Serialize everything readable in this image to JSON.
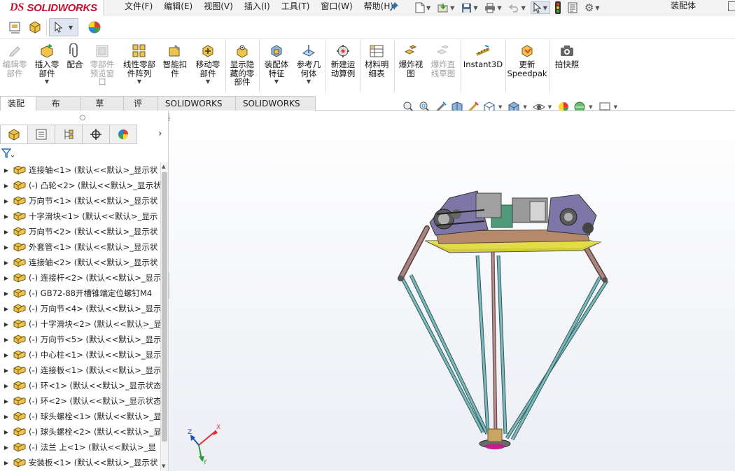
{
  "app": {
    "logo_text": "SOLIDWORKS",
    "logo_mark": "DS"
  },
  "menu": [
    {
      "label": "文件(F)"
    },
    {
      "label": "编辑(E)"
    },
    {
      "label": "视图(V)"
    },
    {
      "label": "插入(I)"
    },
    {
      "label": "工具(T)"
    },
    {
      "label": "窗口(W)"
    },
    {
      "label": "帮助(H)"
    }
  ],
  "document": {
    "title": "装配体"
  },
  "commands": [
    {
      "label": "编辑零\n部件",
      "icon": "edit-component-icon",
      "enabled": false
    },
    {
      "label": "插入零\n部件",
      "icon": "insert-component-icon",
      "enabled": true
    },
    {
      "label": "配合",
      "icon": "mate-icon",
      "enabled": true
    },
    {
      "label": "零部件\n预览窗\n口",
      "icon": "component-preview-icon",
      "enabled": false
    },
    {
      "label": "线性零部\n件阵列",
      "icon": "linear-pattern-icon",
      "enabled": true
    },
    {
      "label": "智能扣\n件",
      "icon": "smart-fasteners-icon",
      "enabled": true
    },
    {
      "label": "移动零\n部件",
      "icon": "move-component-icon",
      "enabled": true
    },
    {
      "label": "显示隐\n藏的零\n部件",
      "icon": "show-hidden-icon",
      "enabled": true
    },
    {
      "label": "装配体\n特征",
      "icon": "assembly-features-icon",
      "enabled": true
    },
    {
      "label": "参考几\n何体",
      "icon": "reference-geometry-icon",
      "enabled": true
    },
    {
      "label": "新建运\n动算例",
      "icon": "motion-study-icon",
      "enabled": true
    },
    {
      "label": "材料明\n细表",
      "icon": "bom-icon",
      "enabled": true
    },
    {
      "label": "爆炸视\n图",
      "icon": "exploded-view-icon",
      "enabled": true
    },
    {
      "label": "爆炸直\n线草图",
      "icon": "explode-line-icon",
      "enabled": false
    },
    {
      "label": "Instant3D",
      "icon": "instant3d-icon",
      "enabled": true
    },
    {
      "label": "更新\nSpeedpak",
      "icon": "speedpak-icon",
      "enabled": true
    },
    {
      "label": "拍快照",
      "icon": "snapshot-icon",
      "enabled": true
    }
  ],
  "tabs": [
    {
      "label": "装配体",
      "active": true
    },
    {
      "label": "布局"
    },
    {
      "label": "草图"
    },
    {
      "label": "评估"
    },
    {
      "label": "SOLIDWORKS 插件"
    },
    {
      "label": "SOLIDWORKS MBD"
    }
  ],
  "tree": [
    {
      "label": "连接轴<1> (默认<<默认>_显示状"
    },
    {
      "label": "(-) 凸轮<2> (默认<<默认>_显示状"
    },
    {
      "label": "万向节<1> (默认<<默认>_显示状"
    },
    {
      "label": "十字滑块<1> (默认<<默认>_显示"
    },
    {
      "label": "万向节<2> (默认<<默认>_显示状"
    },
    {
      "label": "外套管<1> (默认<<默认>_显示状"
    },
    {
      "label": "连接轴<2> (默认<<默认>_显示状"
    },
    {
      "label": "(-) 连接杆<2> (默认<<默认>_显示"
    },
    {
      "label": "(-) GB72-88开槽锥端定位螺钉M4"
    },
    {
      "label": "(-) 万向节<4> (默认<<默认>_显示"
    },
    {
      "label": "(-) 十字滑块<2> (默认<<默认>_显"
    },
    {
      "label": "(-) 万向节<5> (默认<<默认>_显示"
    },
    {
      "label": "(-) 中心柱<1> (默认<<默认>_显示"
    },
    {
      "label": "(-) 连接板<1> (默认<<默认>_显示"
    },
    {
      "label": "(-) 环<1> (默认<<默认>_显示状态"
    },
    {
      "label": "(-) 环<2> (默认<<默认>_显示状态"
    },
    {
      "label": "(-) 球头螺栓<1> (默认<<默认>_显"
    },
    {
      "label": "(-) 球头螺栓<2> (默认<<默认>_显"
    },
    {
      "label": "(-) 法兰 上<1> (默认<<默认>_显"
    },
    {
      "label": "安装板<1> (默认<<默认>_显示状"
    }
  ],
  "triad": {
    "x": "X",
    "y": "Y",
    "z": "Z"
  }
}
